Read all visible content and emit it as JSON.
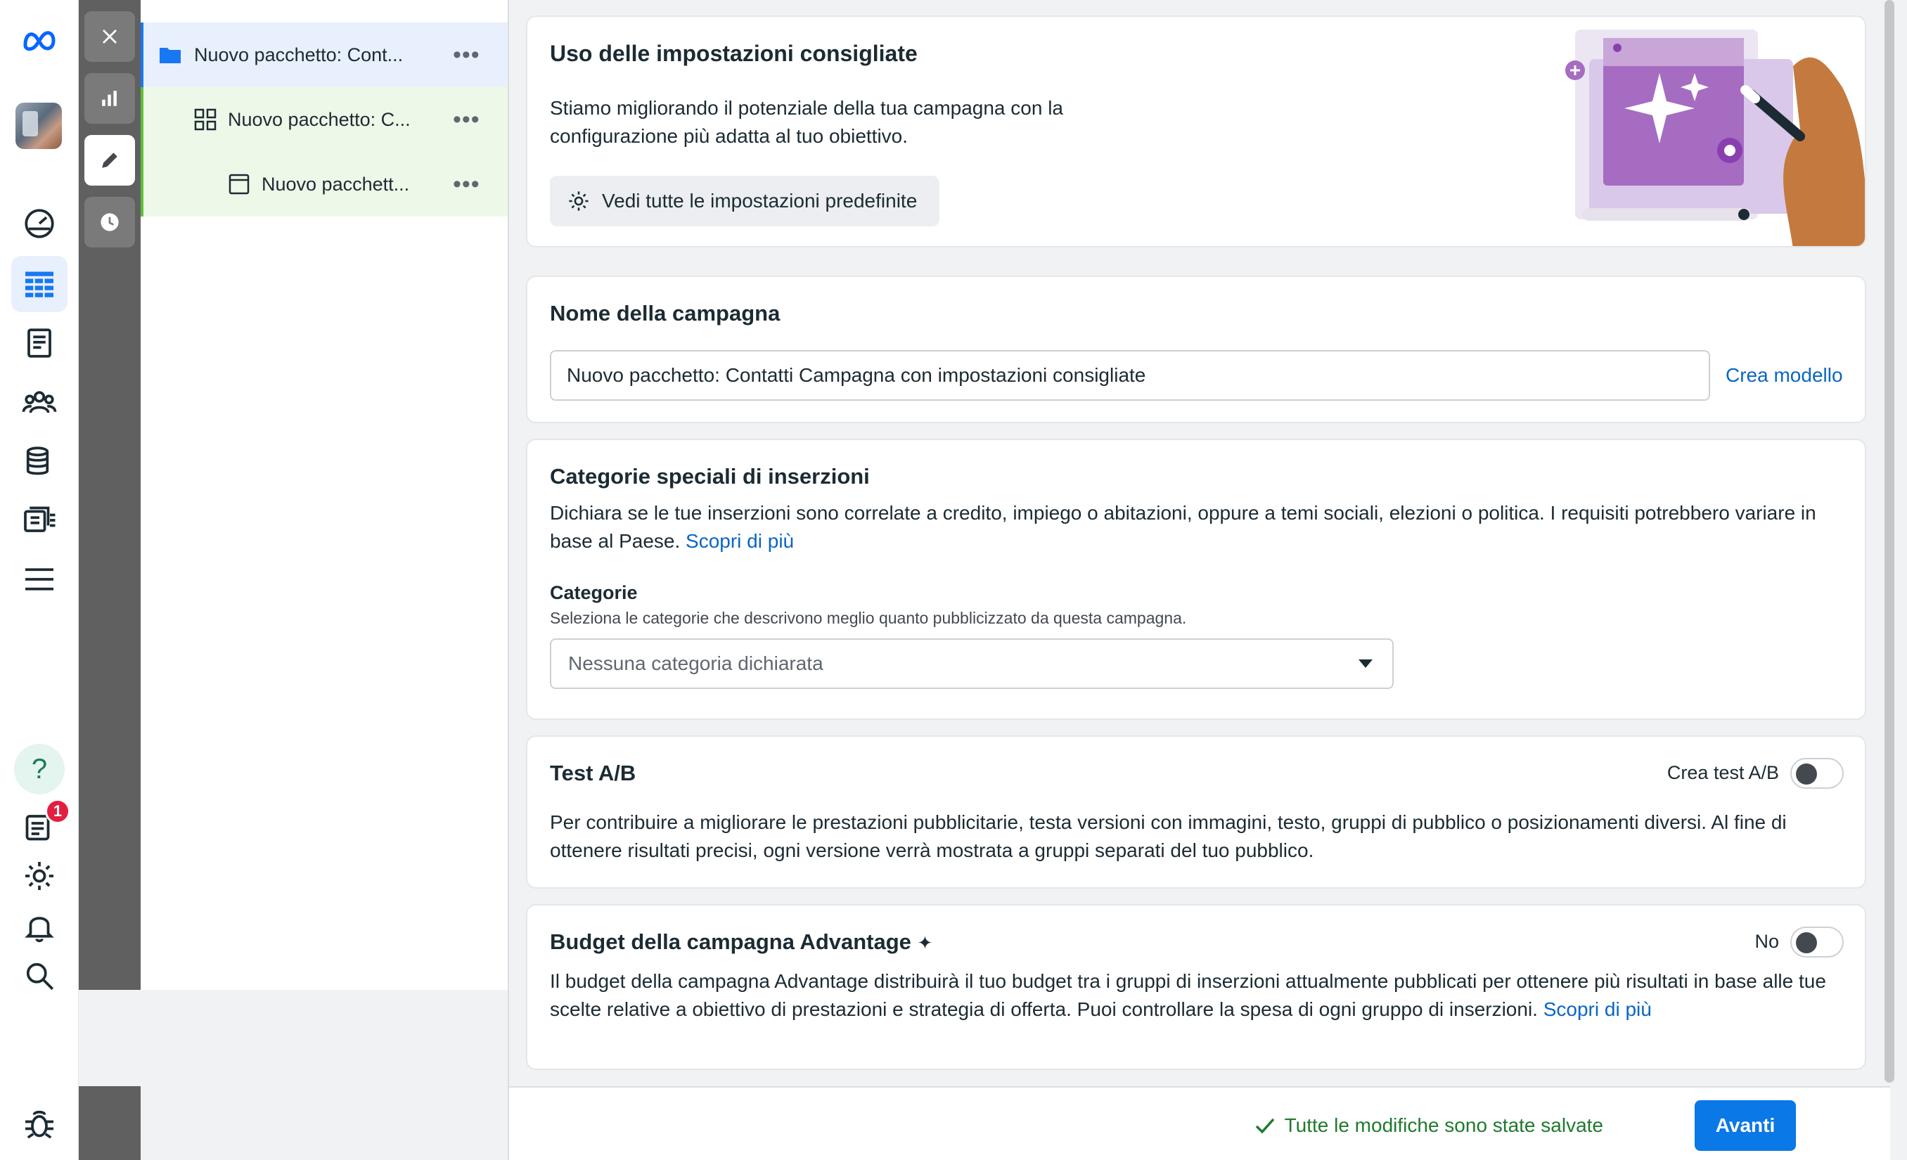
{
  "tree": {
    "items": [
      {
        "label": "Nuovo pacchetto: Cont...",
        "icon": "folder-icon"
      },
      {
        "label": "Nuovo pacchetto: C...",
        "icon": "grid-icon"
      },
      {
        "label": "Nuovo pacchett...",
        "icon": "ad-icon"
      }
    ],
    "more": "•••"
  },
  "rail": {
    "icons": [
      "meta-logo-icon",
      "avatar",
      "dashboard-gauge-icon",
      "campaigns-table-icon",
      "pages-icon",
      "audience-icon",
      "billing-stack-icon",
      "catalog-icon",
      "menu-icon",
      "help-icon",
      "notifications-list-icon",
      "settings-gear-icon",
      "bell-icon",
      "search-icon",
      "bug-icon"
    ],
    "help_glyph": "?",
    "notification_count": "1"
  },
  "recommended": {
    "title": "Uso delle impostazioni consigliate",
    "desc_line1": "Stiamo migliorando il potenziale della tua campagna con la",
    "desc_line2": "configurazione più adatta al tuo obiettivo.",
    "button": "Vedi tutte le impostazioni predefinite"
  },
  "campaign_name": {
    "title": "Nome della campagna",
    "value": "Nuovo pacchetto: Contatti Campagna con impostazioni consigliate",
    "link": "Crea modello"
  },
  "special_categories": {
    "title": "Categorie speciali di inserzioni",
    "desc_line1": "Dichiara se le tue inserzioni sono correlate a credito, impiego o abitazioni, oppure a temi sociali, elezioni o politica. I requisiti potrebbero variare in",
    "desc_line2": "base al Paese.",
    "learn_more": "Scopri di più",
    "label": "Categorie",
    "sublabel": "Seleziona le categorie che descrivono meglio quanto pubblicizzato da questa campagna.",
    "select_value": "Nessuna categoria dichiarata"
  },
  "ab_test": {
    "title": "Test A/B",
    "toggle_label": "Crea test A/B",
    "desc_line1": "Per contribuire a migliorare le prestazioni pubblicitarie, testa versioni con immagini, testo, gruppi di pubblico o posizionamenti diversi. Al fine di",
    "desc_line2": "ottenere risultati precisi, ogni versione verrà mostrata a gruppi separati del tuo pubblico."
  },
  "advantage_budget": {
    "title": "Budget della campagna Advantage",
    "title_glyph": "✦",
    "toggle_label": "No",
    "desc_line1": "Il budget della campagna Advantage distribuirà il tuo budget tra i gruppi di inserzioni attualmente pubblicati per ottenere più risultati in base alle tue",
    "desc_line2": "scelte relative a obiettivo di prestazioni e strategia di offerta. Puoi controllare la spesa di ogni gruppo di inserzioni.",
    "learn_more": "Scopri di più"
  },
  "footer": {
    "saved_text": "Tutte le modifiche sono state salvate",
    "next_button": "Avanti"
  },
  "colors": {
    "accent": "#1877f2",
    "link": "#0a66c2",
    "primary_button": "#0a78e6",
    "success": "#1f7a2d",
    "badge": "#e41e3f",
    "tools_strip": "#606060"
  }
}
